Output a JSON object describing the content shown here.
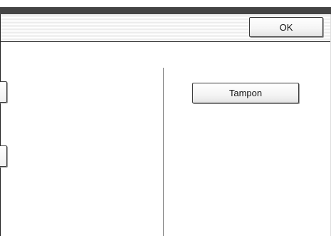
{
  "header": {
    "ok_label": "OK"
  },
  "panel": {
    "tampon_label": "Tampon"
  }
}
